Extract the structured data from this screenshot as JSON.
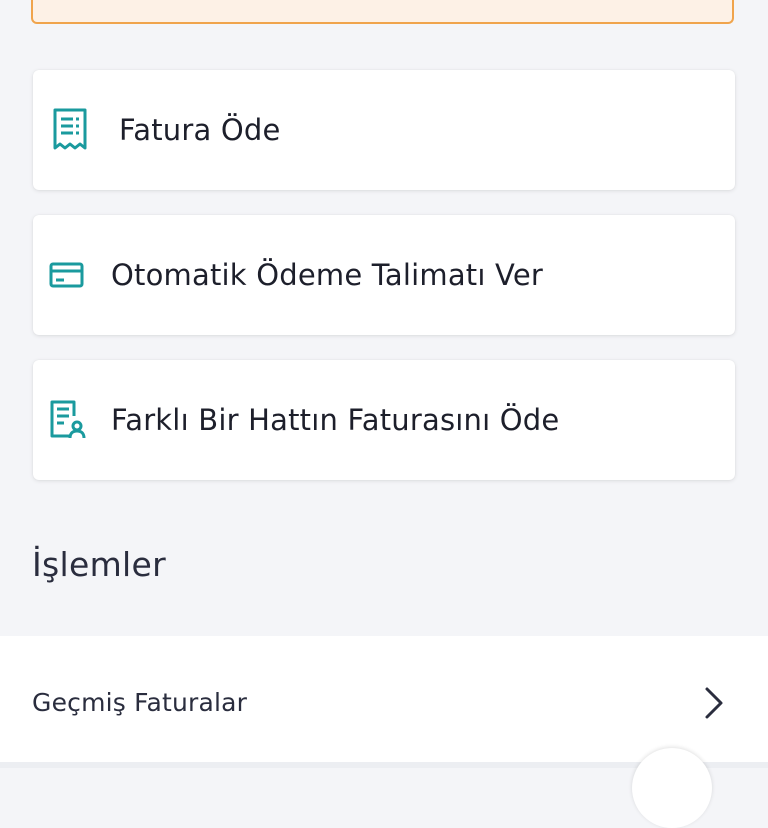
{
  "colors": {
    "page_background": "#f4f5f8",
    "notice_border": "#f0a44c",
    "notice_background": "#fdf1e6",
    "icon_teal": "#1a9a9e",
    "text_primary": "#1d1f2b"
  },
  "actions": [
    {
      "label": "Fatura Öde",
      "icon": "receipt-icon"
    },
    {
      "label": "Otomatik Ödeme Talimatı Ver",
      "icon": "credit-card-icon"
    },
    {
      "label": "Farklı Bir Hattın Faturasını Öde",
      "icon": "receipt-person-icon"
    }
  ],
  "section": {
    "title": "İşlemler"
  },
  "list": {
    "items": [
      {
        "label": "Geçmiş Faturalar",
        "icon": "chevron-right-icon"
      }
    ]
  }
}
